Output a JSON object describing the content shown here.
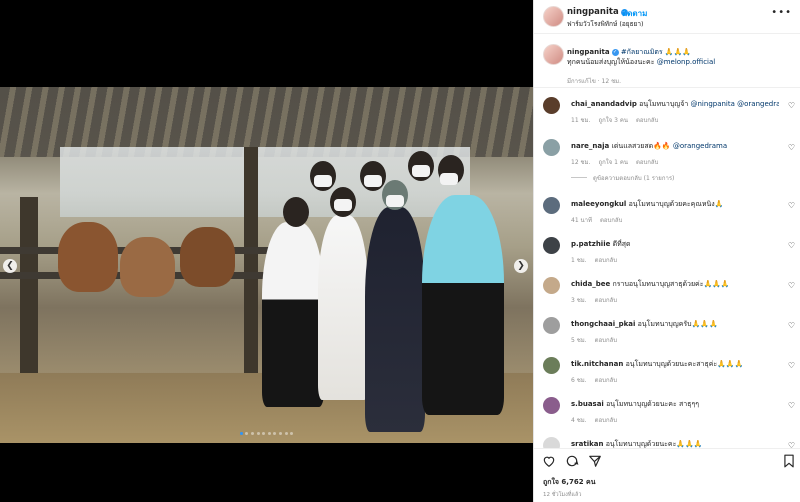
{
  "header": {
    "username": "ningpanita",
    "follow_label": "ติดตาม",
    "location": "ฟาร์มวัวโรงพิทักษ์ (อยุธยา)",
    "more": "•••"
  },
  "caption": {
    "username": "ningpanita",
    "hashtag": "#กัลยาณมิตร",
    "emoji": "🙏🙏🙏",
    "line2": "ทุกคนน้อมส่งบุญให้น้องนะคะ",
    "mention": "@melonp.official",
    "edited": "มีการแก้ไข · 12 ชม."
  },
  "comments": [
    {
      "username": "chai_anandadvip",
      "text": "อนุโมทนาบุญจ้า",
      "mentions": "@ningpanita @orangedrama",
      "time": "11 ชม.",
      "likes": "ถูกใจ 3 คน",
      "reply": "ตอบกลับ",
      "avatar_color": "#5a3d2b"
    },
    {
      "username": "nare_naja",
      "text": "เด่นแลสวยสด🔥🔥",
      "mentions": "@orangedrama",
      "time": "12 ชม.",
      "likes": "ถูกใจ 1 คน",
      "reply": "ตอบกลับ",
      "avatar_color": "#8aa0a5"
    },
    {
      "username": "maleeyongkul",
      "text": "อนุโมทนาบุญด้วยคะคุณหนิง🙏",
      "mentions": "",
      "time": "41 นาที",
      "likes": "",
      "reply": "ตอบกลับ",
      "avatar_color": "#5c6c7d"
    },
    {
      "username": "p.patzhiie",
      "text": "ดีที่สุด",
      "mentions": "",
      "time": "1 ชม.",
      "likes": "",
      "reply": "ตอบกลับ",
      "avatar_color": "#3d4247"
    },
    {
      "username": "chida_bee",
      "text": "กราบอนุโมทนาบุญสาธุด้วยค่ะ🙏🙏🙏",
      "mentions": "",
      "time": "3 ชม.",
      "likes": "",
      "reply": "ตอบกลับ",
      "avatar_color": "#c4a98a"
    },
    {
      "username": "thongchaai_pkai",
      "text": "อนุโมทนาบุญครับ🙏🙏🙏",
      "mentions": "",
      "time": "5 ชม.",
      "likes": "",
      "reply": "ตอบกลับ",
      "avatar_color": "#9e9e9e"
    },
    {
      "username": "tik.nitchanan",
      "text": "อนุโมทนาบุญด้วยนะคะสาธุค่ะ🙏🙏🙏",
      "mentions": "",
      "time": "6 ชม.",
      "likes": "",
      "reply": "ตอบกลับ",
      "avatar_color": "#6b7d5a"
    },
    {
      "username": "s.buasai",
      "text": "อนุโมทนาบุญด้วยนะคะ สาธุๆๆ",
      "mentions": "",
      "time": "4 ชม.",
      "likes": "",
      "reply": "ตอบกลับ",
      "avatar_color": "#8a5d8c"
    },
    {
      "username": "sratikan",
      "text": "อนุโมทนาบุญด้วยนะคะ🙏🙏🙏",
      "mentions": "",
      "time": "",
      "likes": "",
      "reply": "",
      "avatar_color": "#d9d9d9"
    }
  ],
  "replies_label": "ดูข้อความตอบกลับ (1 รายการ)",
  "actions": {
    "likes": "ถูกใจ 6,762 คน",
    "time": "12 ชั่วโมงที่แล้ว"
  },
  "carousel": {
    "slide_count": 10,
    "active_index": 0
  },
  "colors": {
    "accent": "#0095f6",
    "verified": "#3897f0"
  }
}
